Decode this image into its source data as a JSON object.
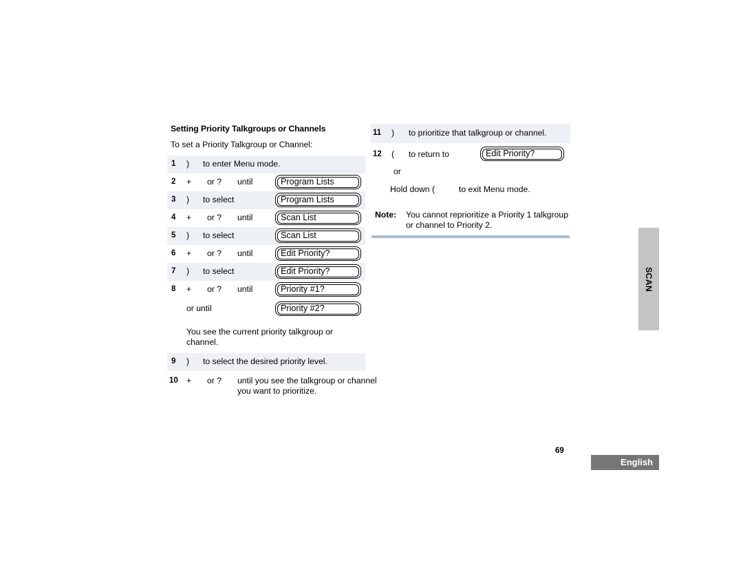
{
  "document": {
    "section_title": "Setting Priority Talkgroups or Channels",
    "lead_text": "To set a Priority Talkgroup or Channel:",
    "page_number": "69",
    "language_badge": "English",
    "side_tab_label": "SCAN"
  },
  "left_column": {
    "steps": [
      {
        "num": "1",
        "key": ")",
        "desc": "to enter Menu mode.",
        "shaded": true
      },
      {
        "num": "2",
        "key": "+",
        "or_key": "or ?",
        "until": "until",
        "display": "Program Lists",
        "shaded": false
      },
      {
        "num": "3",
        "key": ")",
        "desc": "to select",
        "display": "Program Lists",
        "shaded": true
      },
      {
        "num": "4",
        "key": "+",
        "or_key": "or ?",
        "until": "until",
        "display": "Scan List",
        "shaded": false
      },
      {
        "num": "5",
        "key": ")",
        "desc": "to select",
        "display": "Scan List",
        "shaded": true
      },
      {
        "num": "6",
        "key": "+",
        "or_key": "or ?",
        "until": "until",
        "display": "Edit Priority?",
        "shaded": false
      },
      {
        "num": "7",
        "key": ")",
        "desc": "to select",
        "display": "Edit Priority?",
        "shaded": true
      }
    ],
    "step8": {
      "num": "8",
      "key": "+",
      "or_key": "or ?",
      "until": "until",
      "display1": "Priority #1?",
      "or_until": "or until",
      "display2": "Priority #2?",
      "result_text": "You see the current priority talkgroup or channel."
    },
    "step9": {
      "num": "9",
      "key": ")",
      "desc": "to select the desired priority level."
    },
    "step10": {
      "num": "10",
      "key": "+",
      "or_key": "or ?",
      "desc": "until you see the talkgroup or channel you want to prioritize."
    }
  },
  "right_column": {
    "step11": {
      "num": "11",
      "key": ")",
      "desc": "to prioritize that talkgroup or channel."
    },
    "step12": {
      "num": "12",
      "key": "(",
      "desc": "to return to",
      "display": "Edit Priority?",
      "or_text": "or",
      "hold_text": "Hold down (",
      "hold_text_rest": "to exit Menu mode."
    },
    "note": {
      "label": "Note:",
      "body": "You cannot reprioritize a Priority 1 talkgroup or channel to Priority 2."
    }
  }
}
